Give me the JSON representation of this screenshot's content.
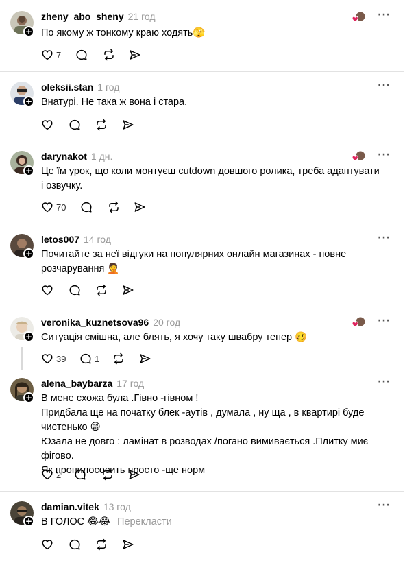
{
  "ui": {
    "follow_symbol": "+",
    "more_symbol": "···",
    "translate_label": "Перекласти"
  },
  "colors": {
    "text": "#000000",
    "muted": "#999999",
    "like_heart": "#e0245e",
    "divider": "#e2e2e2"
  },
  "icons": [
    "heart-icon",
    "comment-icon",
    "repost-icon",
    "share-icon",
    "more-icon",
    "plus-icon"
  ],
  "comments": [
    {
      "username": "zheny_abo_sheny",
      "time": "21 год",
      "text": "По якому ж тонкому краю ходять🫣",
      "likes": "7",
      "replies": "",
      "liked_by_author": true
    },
    {
      "username": "oleksii.stan",
      "time": "1 год",
      "text": "Внатурі. Не така ж вона і стара.",
      "likes": "",
      "replies": "",
      "liked_by_author": false
    },
    {
      "username": "darynakot",
      "time": "1 дн.",
      "text": "Це їм урок, що коли монтуєш cutdown довшого ролика, треба адаптувати і озвучку.",
      "likes": "70",
      "replies": "",
      "liked_by_author": true
    },
    {
      "username": "letos007",
      "time": "14 год",
      "text": "Почитайте за неї відгуки на популярних онлайн магазинах - повне розчарування 🤦",
      "likes": "",
      "replies": "",
      "liked_by_author": false
    },
    {
      "username": "veronika_kuznetsova96",
      "time": "20 год",
      "text": "Ситуація смішна, але блять, я хочу таку швабру тепер 🥴",
      "likes": "39",
      "replies": "1",
      "liked_by_author": true
    },
    {
      "username": "alena_baybarza",
      "time": "17 год",
      "text_lines": [
        "В мене схожа була .Гівно -гівном !",
        "Придбала ще на початку блек -аутів , думала , ну ща , в квартирі буде чистенько 😁",
        "Юзала не довго : ламінат в розводах /погано вимивається .Плитку миє фігово.",
        "Як пропилососить просто -ще норм"
      ],
      "likes": "2",
      "replies": "",
      "liked_by_author": false
    },
    {
      "username": "damian.vitek",
      "time": "13 год",
      "text": "В ГОЛОС 😂😂",
      "likes": "",
      "replies": "",
      "liked_by_author": false
    }
  ]
}
